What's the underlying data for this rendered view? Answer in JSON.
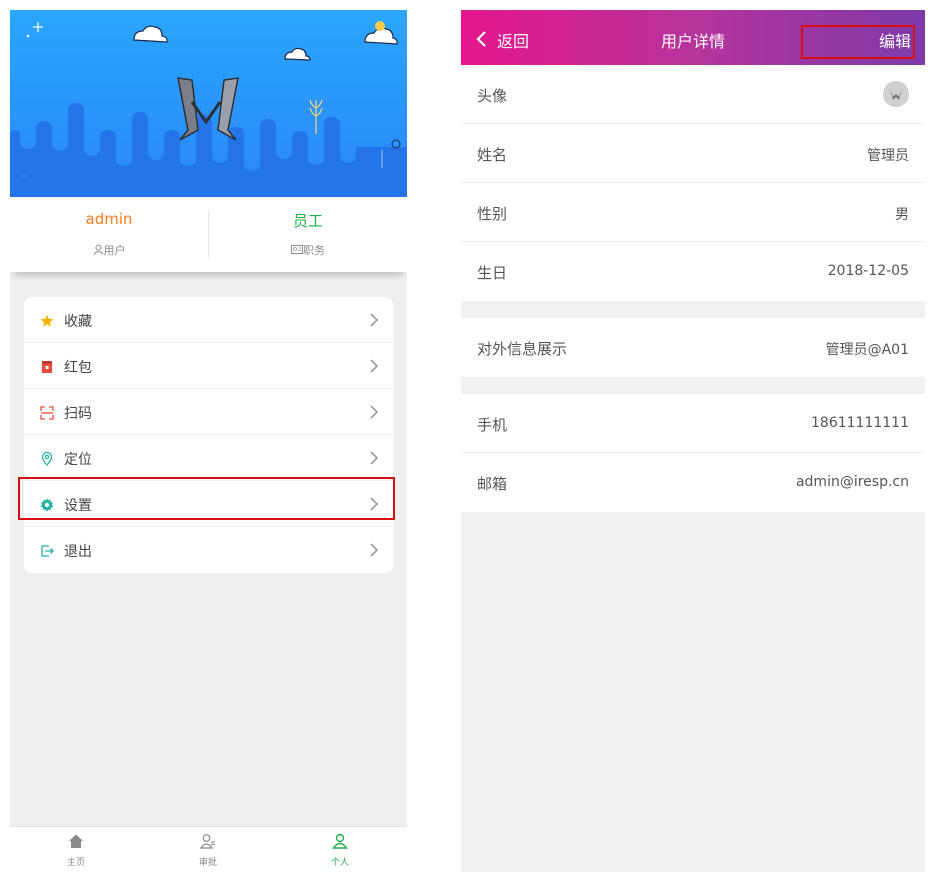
{
  "left": {
    "profile": {
      "username": "admin",
      "username_caption": "用户",
      "role": "员工",
      "role_caption": "职务"
    },
    "menu": [
      {
        "label": "收藏",
        "icon": "star-icon",
        "color": "#f5b400"
      },
      {
        "label": "红包",
        "icon": "red-packet-icon",
        "color": "#e94b3c"
      },
      {
        "label": "扫码",
        "icon": "scan-icon",
        "color": "#e94b3c"
      },
      {
        "label": "定位",
        "icon": "location-icon",
        "color": "#26b1a4"
      },
      {
        "label": "设置",
        "icon": "gear-icon",
        "color": "#26b1a4"
      },
      {
        "label": "退出",
        "icon": "logout-icon",
        "color": "#26b1a4"
      }
    ],
    "tabs": [
      {
        "label": "主页",
        "icon": "home-icon"
      },
      {
        "label": "审批",
        "icon": "approval-icon"
      },
      {
        "label": "个人",
        "icon": "person-icon"
      }
    ],
    "colors": {
      "hero_blue": "#2a95fb",
      "username_orange": "#f57c1f",
      "role_green": "#21b04b",
      "highlight_red": "#d80f0f"
    }
  },
  "right": {
    "nav": {
      "back_label": "返回",
      "title": "用户详情",
      "edit_label": "编辑"
    },
    "group1": [
      {
        "label": "头像",
        "value": ""
      },
      {
        "label": "姓名",
        "value": "管理员"
      },
      {
        "label": "性别",
        "value": "男"
      },
      {
        "label": "生日",
        "value": "2018-12-05"
      }
    ],
    "group2": [
      {
        "label": "对外信息展示",
        "value": "管理员@A01"
      }
    ],
    "group3": [
      {
        "label": "手机",
        "value": "18611111111"
      },
      {
        "label": "邮箱",
        "value": "admin@iresp.cn"
      }
    ],
    "colors": {
      "nav_start": "#e6168d",
      "nav_end": "#7c3aa8"
    }
  }
}
